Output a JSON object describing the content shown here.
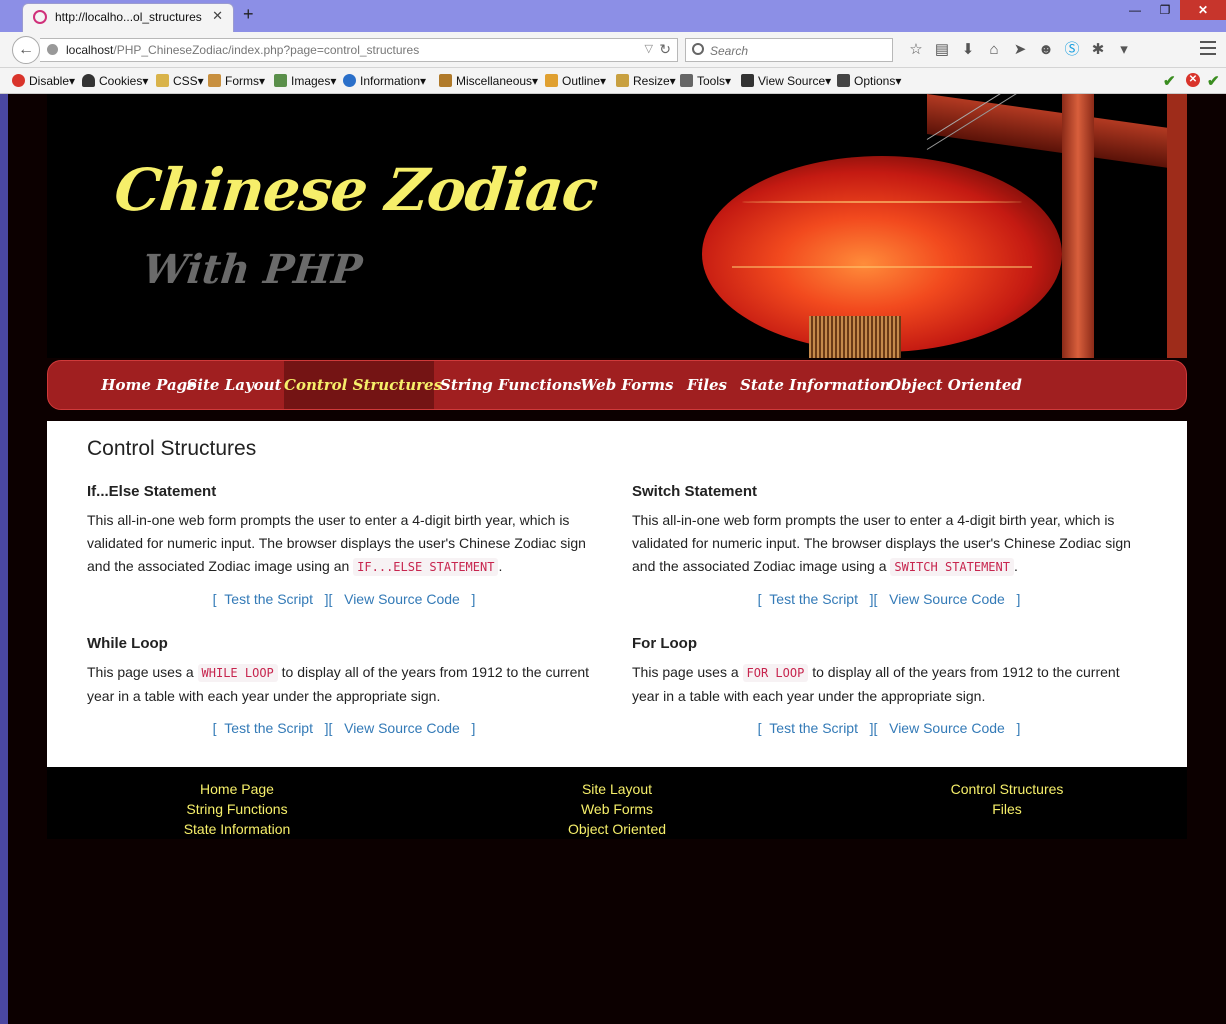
{
  "browser": {
    "tab_title": "http://localho...ol_structures",
    "url_host": "localhost",
    "url_path": "/PHP_ChineseZodiac/index.php?page=control_structures",
    "search_placeholder": "Search"
  },
  "devbar": {
    "items": [
      "Disable▾",
      "Cookies▾",
      "CSS▾",
      "Forms▾",
      "Images▾",
      "Information▾",
      "Miscellaneous▾",
      "Outline▾",
      "Resize▾",
      "Tools▾",
      "View Source▾",
      "Options▾"
    ]
  },
  "banner": {
    "title": "Chinese Zodiac",
    "subtitle": "With PHP"
  },
  "nav": {
    "items": [
      "Home Page",
      "Site Layout",
      "Control Structures",
      "String Functions",
      "Web Forms",
      "Files",
      "State Information",
      "Object Oriented"
    ],
    "active": "Control Structures"
  },
  "content": {
    "title": "Control Structures",
    "cards": [
      {
        "heading": "If...Else Statement",
        "text_before": "This all-in-one web form prompts the user to enter a 4-digit birth year, which is validated for numeric input. The browser displays the user's Chinese Zodiac sign and the associated Zodiac image using an ",
        "code": "IF...ELSE STATEMENT",
        "text_after": ".",
        "link_test": "Test the Script",
        "link_source": "View Source Code"
      },
      {
        "heading": "Switch Statement",
        "text_before": "This all-in-one web form prompts the user to enter a 4-digit birth year, which is validated for numeric input. The browser displays the user's Chinese Zodiac sign and the associated Zodiac image using a ",
        "code": "SWITCH STATEMENT",
        "text_after": ".",
        "link_test": "Test the Script",
        "link_source": "View Source Code"
      },
      {
        "heading": "While Loop",
        "text_before": "This page uses a ",
        "code": "WHILE LOOP",
        "text_after": " to display all of the years from 1912 to the current year in a table with each year under the appropriate sign.",
        "link_test": "Test the Script",
        "link_source": "View Source Code"
      },
      {
        "heading": "For Loop",
        "text_before": "This page uses a ",
        "code": "FOR LOOP",
        "text_after": " to display all of the years from 1912 to the current year in a table with each year under the appropriate sign.",
        "link_test": "Test the Script",
        "link_source": "View Source Code"
      }
    ]
  },
  "footer": {
    "col1": [
      "Home Page",
      "String Functions",
      "State Information"
    ],
    "col2": [
      "Site Layout",
      "Web Forms",
      "Object Oriented"
    ],
    "col3": [
      "Control Structures",
      "Files"
    ]
  },
  "colors": {
    "nav_bg": "#a01f20",
    "nav_active_bg": "#741414",
    "accent_yellow": "#f6ef6a",
    "link_blue": "#337ab7",
    "code_red": "#c7254e"
  }
}
